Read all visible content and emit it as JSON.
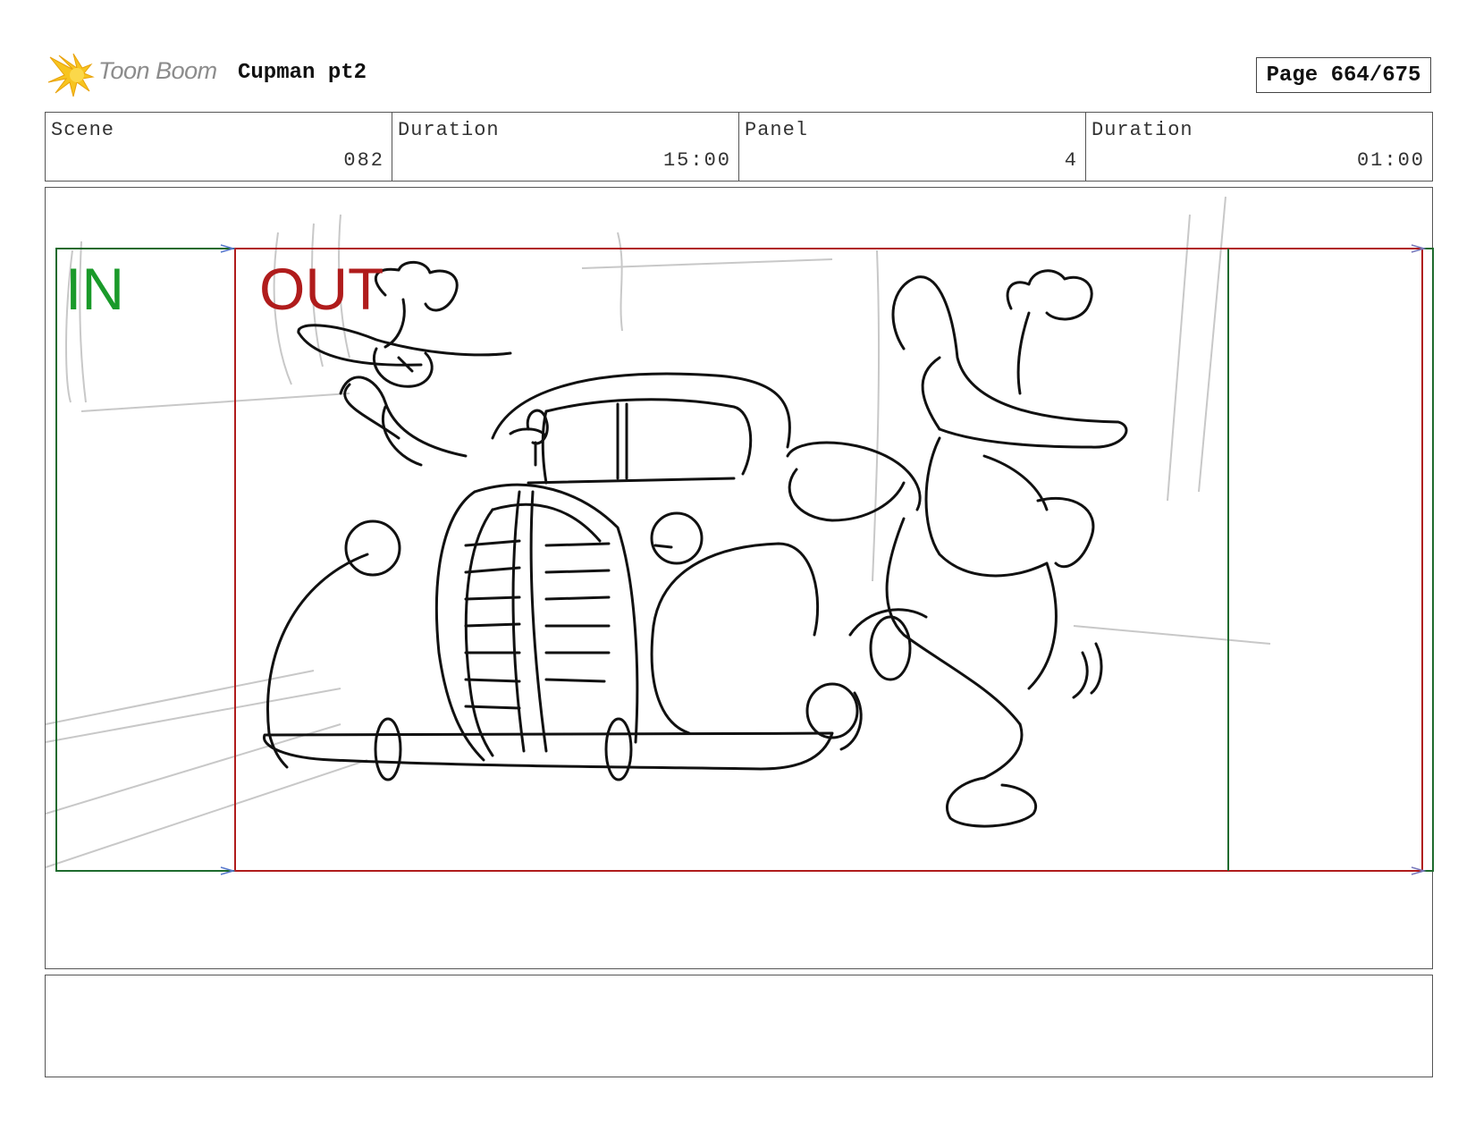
{
  "header": {
    "logo_text": "Toon Boom",
    "project_title": "Cupman pt2",
    "page_label": "Page 664/675"
  },
  "info": [
    {
      "label": "Scene",
      "value": "082"
    },
    {
      "label": "Duration",
      "value": "15:00"
    },
    {
      "label": "Panel",
      "value": "4"
    },
    {
      "label": "Duration",
      "value": "01:00"
    }
  ],
  "panel": {
    "in_label": "IN",
    "out_label": "OUT",
    "in_color": "#1a9a2a",
    "out_color": "#b01c1c"
  },
  "notes": {
    "text": ""
  }
}
